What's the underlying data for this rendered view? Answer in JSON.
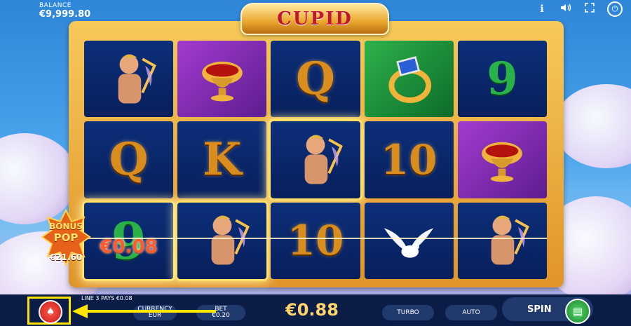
{
  "hud": {
    "balance_label": "BALANCE",
    "balance_value": "€9,999.80"
  },
  "top_icons": [
    "info-icon",
    "sound-icon",
    "fullscreen-icon",
    "power-icon"
  ],
  "logo": {
    "text": "CUPID"
  },
  "reels": [
    [
      "cupid",
      "Q",
      "9"
    ],
    [
      "goblet",
      "K",
      "cupid"
    ],
    [
      "Q",
      "cupid",
      "10"
    ],
    [
      "ring",
      "10",
      "dove"
    ],
    [
      "9",
      "goblet",
      "cupid"
    ]
  ],
  "win_cell_amount": "€0.08",
  "bonus": {
    "line1": "BONUS",
    "line2": "POP",
    "amount": "€21.60"
  },
  "bottom": {
    "line_pays": "LINE 3 PAYS €0.08",
    "currency_label": "CURRENCY",
    "currency_value": "EUR",
    "bet_label": "BET",
    "bet_value": "€0.20",
    "win_value": "€0.88",
    "turbo": "TURBO",
    "auto": "AUTO",
    "spin": "SPIN"
  },
  "colors": {
    "accent_gold": "#e9a62d",
    "highlight": "#ffe500",
    "spin_green": "#16892c"
  }
}
